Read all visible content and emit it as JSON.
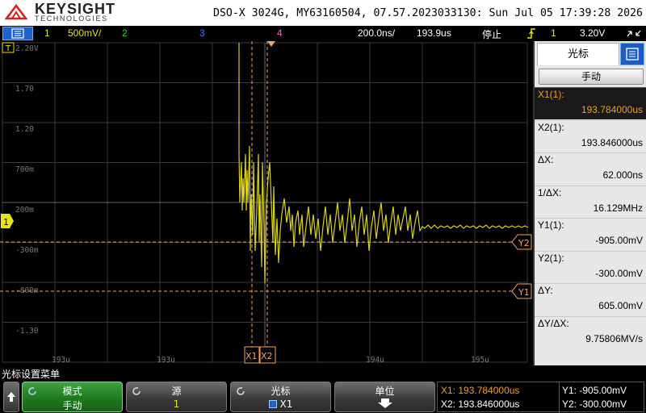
{
  "header": {
    "brand_name": "KEYSIGHT",
    "brand_sub": "TECHNOLOGIES",
    "device_info": "DSO-X 3024G, MY63160504, 07.57.2023033130: Sun Jul 05 17:39:28 2026"
  },
  "status": {
    "ch1_num": "1",
    "ch1_scale": "500mV/",
    "ch2_num": "2",
    "ch3_num": "3",
    "ch4_num": "4",
    "timebase": "200.0ns/",
    "delay": "193.9us",
    "run_state": "停止",
    "trigger_channel": "1",
    "trigger_level": "3.20V"
  },
  "waveform": {
    "y_labels": [
      "2.20V",
      "1.70",
      "1.20",
      "700m",
      "200m",
      "-300m",
      "-800m",
      "-1.30"
    ],
    "x_labels": [
      "193u",
      "193u",
      "194u",
      "194u",
      "195u"
    ],
    "trace_color": "#d8d21a",
    "cursor_color": "#f3a35a",
    "markers": {
      "trigger": "T",
      "ground": "1",
      "x1": "X1",
      "x2": "X2",
      "y1": "Y1",
      "y2": "Y2"
    }
  },
  "side_panel": {
    "title": "光标",
    "mode_button": "手动",
    "rows": [
      {
        "label": "X1(1):",
        "value": "193.784000us",
        "selected": true
      },
      {
        "label": "X2(1):",
        "value": "193.846000us",
        "selected": false
      },
      {
        "label": "ΔX:",
        "value": "62.000ns",
        "selected": false
      },
      {
        "label": "1/ΔX:",
        "value": "16.129MHz",
        "selected": false
      },
      {
        "label": "Y1(1):",
        "value": "-905.00mV",
        "selected": false
      },
      {
        "label": "Y2(1):",
        "value": "-300.00mV",
        "selected": false
      },
      {
        "label": "ΔY:",
        "value": "605.00mV",
        "selected": false
      },
      {
        "label": "ΔY/ΔX:",
        "value": "9.75806MV/s",
        "selected": false
      }
    ]
  },
  "menu": {
    "title": "光标设置菜单",
    "softkeys": [
      {
        "label": "模式",
        "value": "手动"
      },
      {
        "label": "源",
        "value": "1"
      },
      {
        "label": "光标",
        "value": "X1"
      },
      {
        "label": "单位",
        "value": ""
      }
    ]
  },
  "readout": {
    "x1": "X1: 193.784000us",
    "x2": "X2: 193.846000us",
    "y1": "Y1: -905.00mV",
    "y2": "Y2: -300.00mV"
  }
}
